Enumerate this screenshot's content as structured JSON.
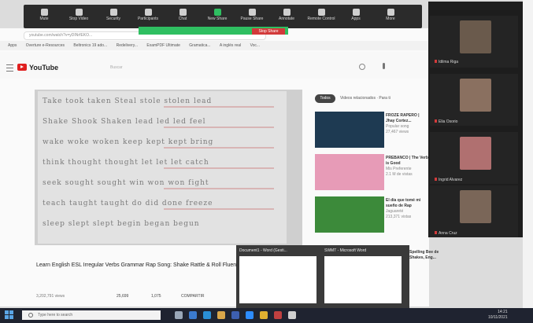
{
  "zoom": {
    "toolbar": [
      {
        "label": "Mute",
        "icon": "mic-icon"
      },
      {
        "label": "Stop Video",
        "icon": "video-icon"
      },
      {
        "label": "Security",
        "icon": "shield-icon"
      },
      {
        "label": "Participants",
        "icon": "participants-icon",
        "count": "5"
      },
      {
        "label": "Chat",
        "icon": "chat-icon"
      },
      {
        "label": "New Share",
        "icon": "share-icon"
      },
      {
        "label": "Pause Share",
        "icon": "pause-icon"
      },
      {
        "label": "Annotate",
        "icon": "pen-icon"
      },
      {
        "label": "Remote Control",
        "icon": "mouse-icon"
      },
      {
        "label": "Apps",
        "icon": "apps-icon"
      },
      {
        "label": "More",
        "icon": "more-icon"
      }
    ],
    "stop_share": "Stop Share",
    "participants": [
      {
        "name": "Idilma Riga"
      },
      {
        "name": "Elia Osorio"
      },
      {
        "name": "Ingrid Alvarez"
      },
      {
        "name": "Anna Cruz"
      }
    ]
  },
  "browser": {
    "address": "youtube.com/watch?v=yDINrfEKO...",
    "bookmarks": [
      "Apps",
      "Overture e-Resources",
      "Beltronics 19 ado...",
      "Redelivery...",
      "ExamPDF Ultimate",
      "Gramatica...",
      "A inglés real",
      "Voc..."
    ]
  },
  "youtube": {
    "wordmark": "YouTube",
    "search_placeholder": "Buscar",
    "chips": [
      "Todos",
      "Videos relacionados · Para ti"
    ],
    "board_rows": [
      "Take   took   taken   Steal   stole   stolen   lead",
      "Shake  Shook  Shaken   lead   led   led   feel",
      "wake   woke   woken   keep   kept   kept   bring",
      "think  thought  thought   let   let   let   catch",
      "seek   sought   sought   win   won   won   fight",
      "teach  taught   taught   do   did   done   freeze",
      "sleep  slept    slept    begin  began  begun"
    ],
    "title": "Learn English ESL Irregular Verbs Grammar Rap Song: Shake Rattle & Roll Fluency MC!",
    "views": "3,202,791 views",
    "likes": "25,699",
    "dislikes": "1,075",
    "share": "COMPARTIR",
    "related": [
      {
        "title": "FROZE RAPERO | Jhay Cortez...",
        "meta": "Popular song",
        "views": "27,467 views"
      },
      {
        "title": "PREBANCO | The Verb is Good",
        "meta": "Mis Preferente",
        "views": "2.1 M de vistas"
      },
      {
        "title": "El día que tomé mi sueño de Rap",
        "meta": "Jaguareté",
        "views": "213,371 vistas"
      },
      {
        "title": "Spelling Bee de Shakes, Eng...",
        "meta": "",
        "views": ""
      }
    ]
  },
  "taskbar": {
    "search_placeholder": "Type here to search",
    "time": "14:21",
    "date": "10/11/2021"
  },
  "previews": [
    {
      "title": "Document1 - Word (Gesti..."
    },
    {
      "title": "SWMT - Microsoft Word"
    }
  ]
}
